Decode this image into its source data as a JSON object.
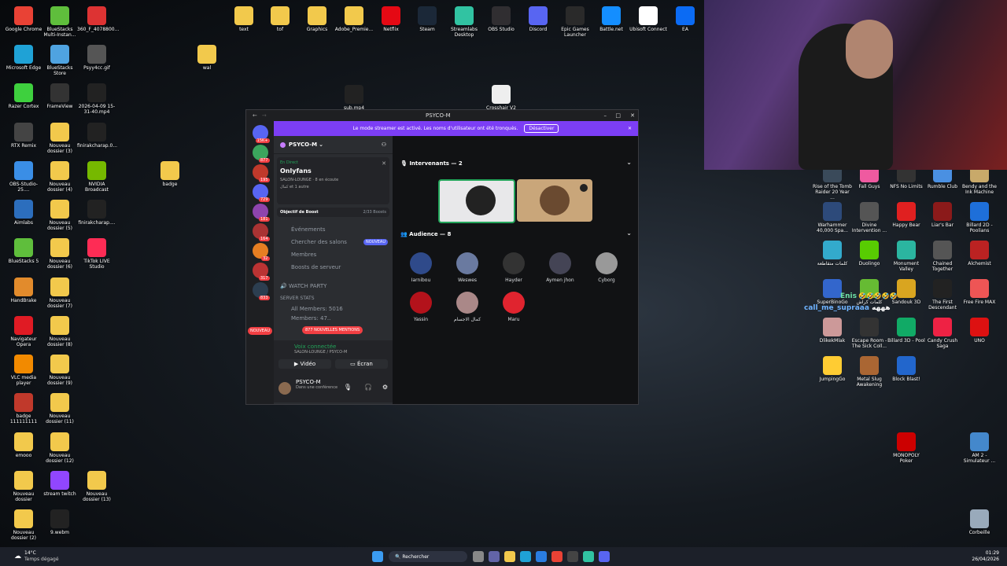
{
  "desktop": {
    "left_icons": [
      {
        "label": "Google Chrome",
        "color": "#e94235"
      },
      {
        "label": "BlueStacks Multi-Instan...",
        "color": "#5fbe3c"
      },
      {
        "label": "360_F_4078800...",
        "color": "#d33"
      },
      {
        "label": "Microsoft Edge",
        "color": "#1fa2d6"
      },
      {
        "label": "BlueStacks Store",
        "color": "#4fa3e0"
      },
      {
        "label": "Psyy4cc.gif",
        "color": "#555"
      },
      {
        "label": "wal",
        "color": "#f2c94c"
      },
      {
        "label": "Razer Cortex",
        "color": "#3ed03e"
      },
      {
        "label": "FrameView",
        "color": "#333"
      },
      {
        "label": "2026-04-09 15-31-40.mp4",
        "color": "#222"
      },
      {
        "label": "RTX Remix",
        "color": "#444"
      },
      {
        "label": "Nouveau dossier (3)",
        "color": "#f2c94c"
      },
      {
        "label": "finirakcharap.0...",
        "color": "#222"
      },
      {
        "label": "OBS-Studio-25....",
        "color": "#3a8ee6"
      },
      {
        "label": "Nouveau dossier (4)",
        "color": "#f2c94c"
      },
      {
        "label": "NVIDIA Broadcast",
        "color": "#76b900"
      },
      {
        "label": "badge",
        "color": "#f2c94c"
      },
      {
        "label": "Aimlabs",
        "color": "#2c6ebd"
      },
      {
        "label": "Nouveau dossier (5)",
        "color": "#f2c94c"
      },
      {
        "label": "finirakcharap....",
        "color": "#222"
      },
      {
        "label": "BlueStacks 5",
        "color": "#5fbe3c"
      },
      {
        "label": "Nouveau dossier (6)",
        "color": "#f2c94c"
      },
      {
        "label": "TikTok LIVE Studio",
        "color": "#fe2c55"
      },
      {
        "label": "HandBrake",
        "color": "#e28b2c"
      },
      {
        "label": "Nouveau dossier (7)",
        "color": "#f2c94c"
      },
      {
        "label": "Navigateur Opera",
        "color": "#e01b24"
      },
      {
        "label": "Nouveau dossier (8)",
        "color": "#f2c94c"
      },
      {
        "label": "VLC media player",
        "color": "#f28a00"
      },
      {
        "label": "Nouveau dossier (9)",
        "color": "#f2c94c"
      },
      {
        "label": "badge 111111111",
        "color": "#c0392b"
      },
      {
        "label": "Nouveau dossier (11)",
        "color": "#f2c94c"
      },
      {
        "label": "emooo",
        "color": "#f2c94c"
      },
      {
        "label": "Nouveau dossier (12)",
        "color": "#f2c94c"
      },
      {
        "label": "Nouveau dossier",
        "color": "#f2c94c"
      },
      {
        "label": "stream twitch",
        "color": "#9146ff"
      },
      {
        "label": "Nouveau dossier (13)",
        "color": "#f2c94c"
      },
      {
        "label": "Nouveau dossier (2)",
        "color": "#f2c94c"
      },
      {
        "label": "9.webm",
        "color": "#222"
      }
    ],
    "top_icons": [
      {
        "label": "text",
        "color": "#f2c94c"
      },
      {
        "label": "tof",
        "color": "#f2c94c"
      },
      {
        "label": "Graphics",
        "color": "#f2c94c"
      },
      {
        "label": "Adobe_Premie...",
        "color": "#f2c94c"
      },
      {
        "label": "Netflix",
        "color": "#e50914"
      },
      {
        "label": "Steam",
        "color": "#1b2838"
      },
      {
        "label": "Streamlabs Desktop",
        "color": "#31c3a2"
      },
      {
        "label": "OBS Studio",
        "color": "#302e31"
      },
      {
        "label": "Discord",
        "color": "#5865f2"
      },
      {
        "label": "Epic Games Launcher",
        "color": "#2a2a2a"
      },
      {
        "label": "Battle.net",
        "color": "#148eff"
      },
      {
        "label": "Ubisoft Connect",
        "color": "#ffffff"
      },
      {
        "label": "EA",
        "color": "#0b6bf4"
      },
      {
        "label": "sub.mp4",
        "color": "#222"
      },
      {
        "label": "Crosshair V2",
        "color": "#eee"
      }
    ],
    "right_icons": [
      {
        "label": "Rise of the Tomb Raider 20 Year ...",
        "color": "#3a4a5a"
      },
      {
        "label": "Fall Guys",
        "color": "#ef5aa0"
      },
      {
        "label": "NFS No Limits",
        "color": "#333"
      },
      {
        "label": "Rumble Club",
        "color": "#4a90e2"
      },
      {
        "label": "Bendy and the Ink Machine",
        "color": "#c8a96a"
      },
      {
        "label": "Warhammer 40,000 Spa...",
        "color": "#2d4a7a"
      },
      {
        "label": "Divine Intervention ...",
        "color": "#555"
      },
      {
        "label": "Happy Bear",
        "color": "#e02020"
      },
      {
        "label": "Liar's Bar",
        "color": "#8b1a1a"
      },
      {
        "label": "Billard 2D - Poolians",
        "color": "#1e6fd9"
      },
      {
        "label": "كلمات متقاطعة",
        "color": "#3ac"
      },
      {
        "label": "Duolingo",
        "color": "#58cc02"
      },
      {
        "label": "Monument Valley",
        "color": "#2bb5a0"
      },
      {
        "label": "Chained Together",
        "color": "#555"
      },
      {
        "label": "Alchemist",
        "color": "#b22"
      },
      {
        "label": "SuperBinoGo",
        "color": "#36c"
      },
      {
        "label": "كلمات كراش",
        "color": "#6b3"
      },
      {
        "label": "Sandouk 3D",
        "color": "#d9a520"
      },
      {
        "label": "The First Descendant",
        "color": "#222"
      },
      {
        "label": "Free Fire MAX",
        "color": "#e55"
      },
      {
        "label": "DlikekMlak",
        "color": "#c99"
      },
      {
        "label": "Escape Room - The Sick Coll...",
        "color": "#333"
      },
      {
        "label": "Billard 3D - Pool",
        "color": "#1a6"
      },
      {
        "label": "Candy Crush Saga",
        "color": "#e24"
      },
      {
        "label": "UNO",
        "color": "#d11"
      },
      {
        "label": "JumpingGo",
        "color": "#fc3"
      },
      {
        "label": "Metal Slug Awakening",
        "color": "#a63"
      },
      {
        "label": "Block Blast!",
        "color": "#26c"
      },
      {
        "label": "MONOPOLY Poker",
        "color": "#c00"
      },
      {
        "label": "AM 2 - Simulateur ...",
        "color": "#48c"
      },
      {
        "label": "Corbeille",
        "color": "#9ab"
      }
    ],
    "chat_overlay": {
      "line1": "Enis",
      "line1_tail": "🤣🤣🤣🤣🤣",
      "line2": "call_me_supraaa",
      "line2_msg": "هههه"
    }
  },
  "discord": {
    "window_title": "PSYCO-M",
    "banner_text": "Le mode streamer est activé. Les noms d'utilisateur ont été tronqués.",
    "banner_button": "Désactiver",
    "guild_badges": [
      "15K+",
      "877",
      "195",
      "729",
      "181",
      "164",
      "32",
      "317",
      "833"
    ],
    "server_name": "PSYCO-M",
    "live": {
      "tag": "En Direct",
      "title": "Onlyfans",
      "channel": "SALON-LOUNGE",
      "listening": "8 en écoute",
      "others": "كمال et 1 autre"
    },
    "boost": {
      "label": "Objectif de Boost",
      "progress": "2/33 Boosts"
    },
    "menu": [
      {
        "label": "Événements"
      },
      {
        "label": "Chercher des salons",
        "badge": "NOUVEAU"
      },
      {
        "label": "Membres"
      },
      {
        "label": "Boosts de serveur"
      }
    ],
    "watch_party": "WATCH PARTY",
    "server_stats": "SERVER STATS",
    "all_members": "All Members: 5016",
    "members_cut": "Members: 47..",
    "nouveau_pill": "NOUVEAU",
    "mentions_pill": "877 NOUVELLES MENTIONS",
    "voice": {
      "status": "Voix connectée",
      "channel": "SALON-LOUNGE / PSYCO-M",
      "video": "Vidéo",
      "screen": "Écran"
    },
    "user": {
      "name": "PSYCO-M",
      "status": "Dans une conférence"
    },
    "speakers_header": "Intervenants — 2",
    "audience_header": "Audience — 8",
    "audience": [
      {
        "name": "Iarnibou",
        "color": "#2f4a8a"
      },
      {
        "name": "Weswes",
        "color": "#6a7aa0"
      },
      {
        "name": "Hayder",
        "color": "#333"
      },
      {
        "name": "Aymen jhon",
        "color": "#445"
      },
      {
        "name": "Cyborg",
        "color": "#999"
      },
      {
        "name": "Yassin",
        "color": "#b3121b"
      },
      {
        "name": "كمال الاجسام",
        "color": "#a88"
      },
      {
        "name": "Maru",
        "color": "#e0242f"
      }
    ]
  },
  "taskbar": {
    "weather_temp": "14°C",
    "weather_text": "Temps dégagé",
    "search": "Rechercher",
    "time": "01:29",
    "date": "26/04/2026"
  }
}
